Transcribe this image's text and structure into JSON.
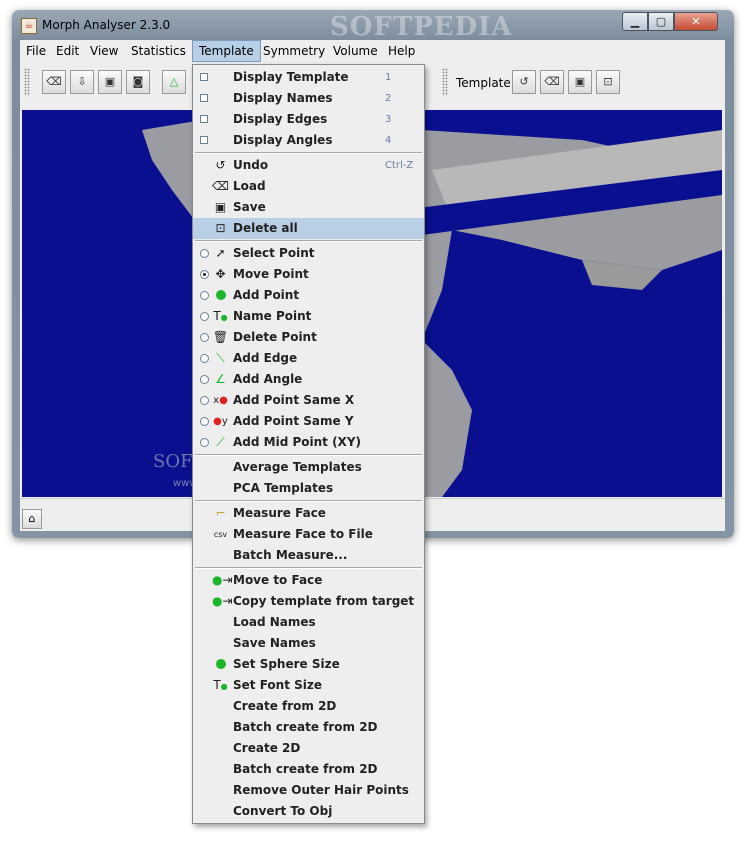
{
  "window": {
    "title": "Morph Analyser 2.3.0",
    "watermark": "SOFTPEDIA",
    "watermark_mid": "SOFTPEDIA",
    "watermark_url": "www.softpedia.com"
  },
  "menubar": {
    "items": [
      "File",
      "Edit",
      "View",
      "Statistics",
      "Template",
      "Symmetry",
      "Volume",
      "Help"
    ],
    "active": "Template"
  },
  "toolbar": {
    "template_label": "Template:"
  },
  "template_menu": {
    "display_items": [
      {
        "label": "Display Template",
        "accel": "1"
      },
      {
        "label": "Display Names",
        "accel": "2"
      },
      {
        "label": "Display Edges",
        "accel": "3"
      },
      {
        "label": "Display Angles",
        "accel": "4"
      }
    ],
    "edit_items": [
      {
        "label": "Undo",
        "accel": "Ctrl-Z"
      },
      {
        "label": "Load",
        "accel": ""
      },
      {
        "label": "Save",
        "accel": ""
      },
      {
        "label": "Delete all",
        "accel": ""
      }
    ],
    "highlighted": "Delete all",
    "point_tools": [
      {
        "label": "Select Point"
      },
      {
        "label": "Move Point"
      },
      {
        "label": "Add Point"
      },
      {
        "label": "Name Point"
      },
      {
        "label": "Delete Point"
      },
      {
        "label": "Add Edge"
      },
      {
        "label": "Add Angle"
      },
      {
        "label": "Add Point Same X"
      },
      {
        "label": "Add Point Same Y"
      },
      {
        "label": "Add Mid Point (XY)"
      }
    ],
    "selected_tool": "Move Point",
    "average_items": [
      "Average Templates",
      "PCA Templates"
    ],
    "measure_items": [
      "Measure Face",
      "Measure Face to File",
      "Batch Measure..."
    ],
    "misc_items": [
      "Move to Face",
      "Copy template from target",
      "Load Names",
      "Save Names",
      "Set Sphere Size",
      "Set Font Size",
      "Create from 2D",
      "Batch create from 2D",
      "Create 2D",
      "Batch create from 2D",
      "Remove Outer Hair Points",
      "Convert To Obj"
    ]
  },
  "colors": {
    "viewport_bg": "#0a0f8f",
    "menu_highlight": "#b8cfe5",
    "mesh_gray": "#a8a8a8"
  }
}
